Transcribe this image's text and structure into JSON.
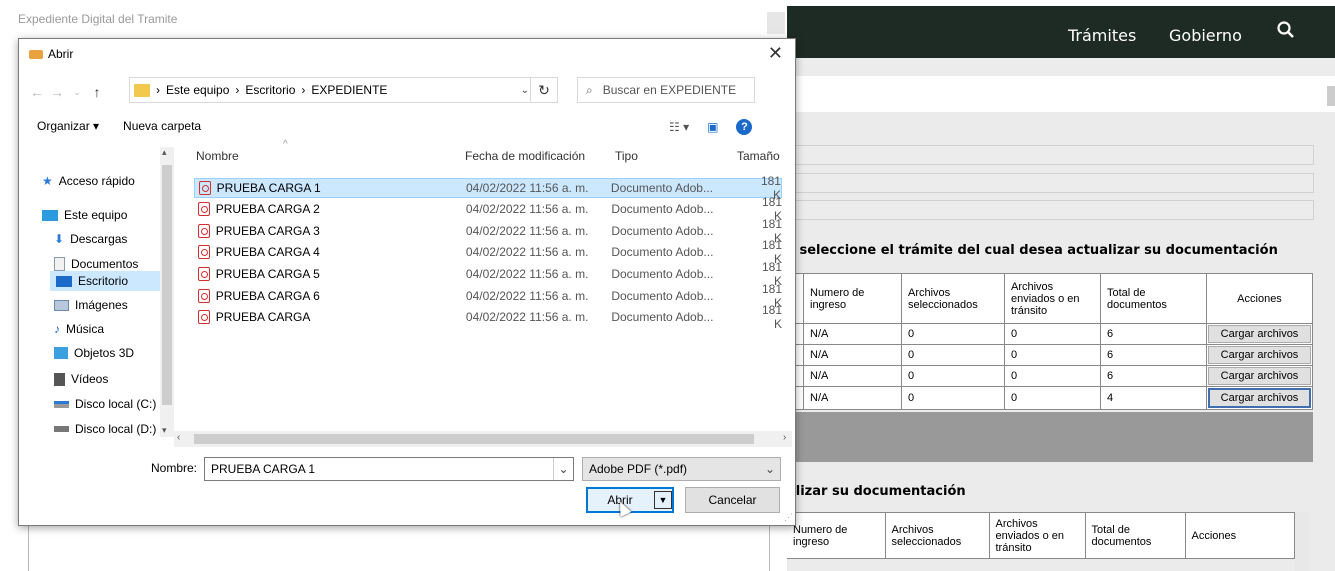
{
  "background": {
    "page_title": "Expediente Digital del Tramite",
    "nav": [
      "Trámites",
      "Gobierno"
    ],
    "heading1": ", seleccione el trámite del cual desea actualizar su documentación",
    "heading2": "alizar su documentación",
    "table_headers": [
      "Numero de ingreso",
      "Archivos seleccionados",
      "Archivos enviados o en tránsito",
      "Total de documentos",
      "Acciones"
    ],
    "table_rows": [
      {
        "ingreso": "N/A",
        "sel": "0",
        "env": "0",
        "total": "6",
        "accion": "Cargar archivos"
      },
      {
        "ingreso": "N/A",
        "sel": "0",
        "env": "0",
        "total": "6",
        "accion": "Cargar archivos"
      },
      {
        "ingreso": "N/A",
        "sel": "0",
        "env": "0",
        "total": "6",
        "accion": "Cargar archivos"
      },
      {
        "ingreso": "N/A",
        "sel": "0",
        "env": "0",
        "total": "4",
        "accion": "Cargar archivos"
      }
    ],
    "table2_headers": [
      "Numero de ingreso",
      "Archivos seleccionados",
      "Archivos enviados o en tránsito",
      "Total de documentos",
      "Acciones"
    ]
  },
  "dialog": {
    "title": "Abrir",
    "path": [
      "Este equipo",
      "Escritorio",
      "EXPEDIENTE"
    ],
    "search_placeholder": "Buscar en EXPEDIENTE",
    "organize": "Organizar ▾",
    "new_folder": "Nueva carpeta",
    "sidebar": [
      {
        "label": "Acceso rápido",
        "icon": "star-icon",
        "color": "#2b7bd6"
      },
      {
        "label": "Este equipo",
        "icon": "computer-icon",
        "color": "#2b9be0"
      },
      {
        "label": "Descargas",
        "icon": "download-icon",
        "color": "#2b7bd6"
      },
      {
        "label": "Documentos",
        "icon": "document-icon",
        "color": "#8a9bb0"
      },
      {
        "label": "Escritorio",
        "icon": "desktop-icon",
        "color": "#1b6ac9"
      },
      {
        "label": "Imágenes",
        "icon": "image-icon",
        "color": "#6a8ab0"
      },
      {
        "label": "Música",
        "icon": "music-icon",
        "color": "#1b6ac9"
      },
      {
        "label": "Objetos 3D",
        "icon": "cube-icon",
        "color": "#3aa0e0"
      },
      {
        "label": "Vídeos",
        "icon": "video-icon",
        "color": "#555555"
      },
      {
        "label": "Disco local (C:)",
        "icon": "drive-icon",
        "color": "#777777"
      },
      {
        "label": "Disco local (D:)",
        "icon": "drive-icon",
        "color": "#777777"
      }
    ],
    "columns": [
      "Nombre",
      "Fecha de modificación",
      "Tipo",
      "Tamaño"
    ],
    "files": [
      {
        "name": "PRUEBA CARGA 1",
        "date": "04/02/2022 11:56 a. m.",
        "type": "Documento Adob...",
        "size": "181 K"
      },
      {
        "name": "PRUEBA CARGA 2",
        "date": "04/02/2022 11:56 a. m.",
        "type": "Documento Adob...",
        "size": "181 K"
      },
      {
        "name": "PRUEBA CARGA 3",
        "date": "04/02/2022 11:56 a. m.",
        "type": "Documento Adob...",
        "size": "181 K"
      },
      {
        "name": "PRUEBA CARGA 4",
        "date": "04/02/2022 11:56 a. m.",
        "type": "Documento Adob...",
        "size": "181 K"
      },
      {
        "name": "PRUEBA CARGA 5",
        "date": "04/02/2022 11:56 a. m.",
        "type": "Documento Adob...",
        "size": "181 K"
      },
      {
        "name": "PRUEBA CARGA 6",
        "date": "04/02/2022 11:56 a. m.",
        "type": "Documento Adob...",
        "size": "181 K"
      },
      {
        "name": "PRUEBA CARGA",
        "date": "04/02/2022 11:56 a. m.",
        "type": "Documento Adob...",
        "size": "181 K"
      }
    ],
    "filename_label": "Nombre:",
    "filename_value": "PRUEBA CARGA 1",
    "filetype": "Adobe PDF (*.pdf)",
    "open_label": "Abrir",
    "cancel_label": "Cancelar"
  }
}
